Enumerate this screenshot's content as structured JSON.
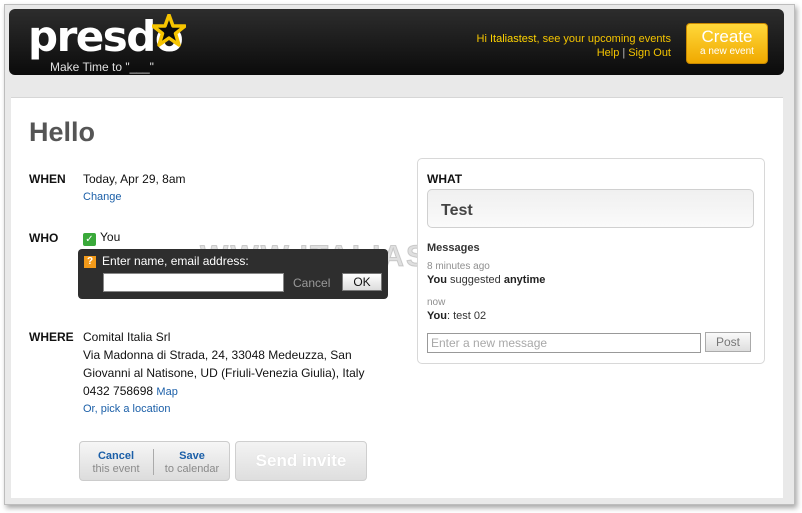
{
  "header": {
    "logo_text": "presdo",
    "tagline": "Make Time to \"___\"",
    "greeting_prefix": "Hi ",
    "username": "Italiastest",
    "greeting_suffix": ", see your upcoming events",
    "help_label": "Help",
    "link_separator": "|",
    "signout_label": "Sign Out",
    "create_label": "Create",
    "create_sub": "a new event"
  },
  "event": {
    "title": "Hello",
    "when_label": "WHEN",
    "when_value": "Today, Apr 29, 8am",
    "change_label": "Change",
    "who_label": "WHO",
    "who_value": "You",
    "where_label": "WHERE",
    "address_line1": "Comital Italia Srl",
    "address_line2": "Via Madonna di Strada, 24, 33048 Medeuzza, San",
    "address_line3": "Giovanni al Natisone, UD (Friuli-Venezia Giulia), Italy",
    "address_phone": "0432 758698",
    "map_label": "Map",
    "pick_location_label": "Or, pick a location"
  },
  "invite_popup": {
    "prompt": "Enter name, email address:",
    "input_value": "",
    "cancel_label": "Cancel",
    "ok_label": "OK"
  },
  "actions": {
    "cancel_label": "Cancel",
    "cancel_sub": "this event",
    "save_label": "Save",
    "save_sub": "to calendar",
    "send_label": "Send invite"
  },
  "what": {
    "label": "WHAT",
    "value": "Test",
    "messages_label": "Messages",
    "messages": [
      {
        "time": "8 minutes ago",
        "author": "You",
        "text": " suggested ",
        "emphasis": "anytime"
      },
      {
        "time": "now",
        "author": "You",
        "text": ": test 02"
      }
    ],
    "input_placeholder": "Enter a new message",
    "post_label": "Post"
  },
  "watermark": "WWW.ITALIASW.COM",
  "colors": {
    "accent_yellow": "#f4c400",
    "link_blue": "#1b5fa8",
    "header_bg": "#111111"
  }
}
